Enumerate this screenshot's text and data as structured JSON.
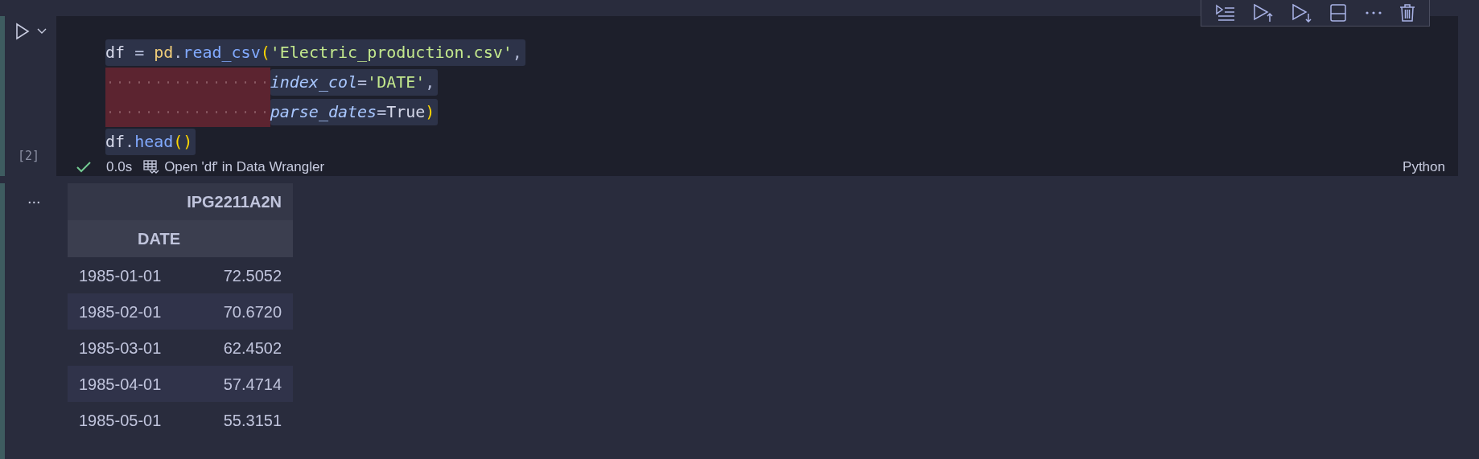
{
  "cell": {
    "focused": true,
    "execution_count": "[2]",
    "succeeded": true,
    "duration": "0.0s",
    "data_wrangler_link": "Open 'df' in Data Wrangler",
    "language": "Python",
    "code_lines": [
      {
        "tokens": [
          {
            "text": "df",
            "kind": "name"
          },
          {
            "text": " = ",
            "kind": "op"
          },
          {
            "text": "pd",
            "kind": "module"
          },
          {
            "text": ".",
            "kind": "op"
          },
          {
            "text": "read_csv",
            "kind": "func"
          },
          {
            "text": "(",
            "kind": "paren"
          },
          {
            "text": "'Electric_production.csv'",
            "kind": "string"
          },
          {
            "text": ",",
            "kind": "op"
          }
        ]
      },
      {
        "indent_warning": true,
        "tokens": [
          {
            "text": "index_col",
            "kind": "param"
          },
          {
            "text": "=",
            "kind": "op"
          },
          {
            "text": "'DATE'",
            "kind": "string"
          },
          {
            "text": ",",
            "kind": "op"
          }
        ]
      },
      {
        "indent_warning": true,
        "tokens": [
          {
            "text": "parse_dates",
            "kind": "param"
          },
          {
            "text": "=",
            "kind": "op"
          },
          {
            "text": "True",
            "kind": "const"
          },
          {
            "text": ")",
            "kind": "paren"
          }
        ]
      },
      {
        "tokens": [
          {
            "text": "df",
            "kind": "name"
          },
          {
            "text": ".",
            "kind": "op"
          },
          {
            "text": "head",
            "kind": "func"
          },
          {
            "text": "()",
            "kind": "paren"
          }
        ]
      }
    ]
  },
  "output": {
    "menu": "...",
    "table": {
      "columns": [
        "IPG2211A2N"
      ],
      "index_name": "DATE",
      "rows": [
        {
          "index": "1985-01-01",
          "value": "72.5052"
        },
        {
          "index": "1985-02-01",
          "value": "70.6720"
        },
        {
          "index": "1985-03-01",
          "value": "62.4502"
        },
        {
          "index": "1985-04-01",
          "value": "57.4714"
        },
        {
          "index": "1985-05-01",
          "value": "55.3151"
        }
      ]
    }
  }
}
